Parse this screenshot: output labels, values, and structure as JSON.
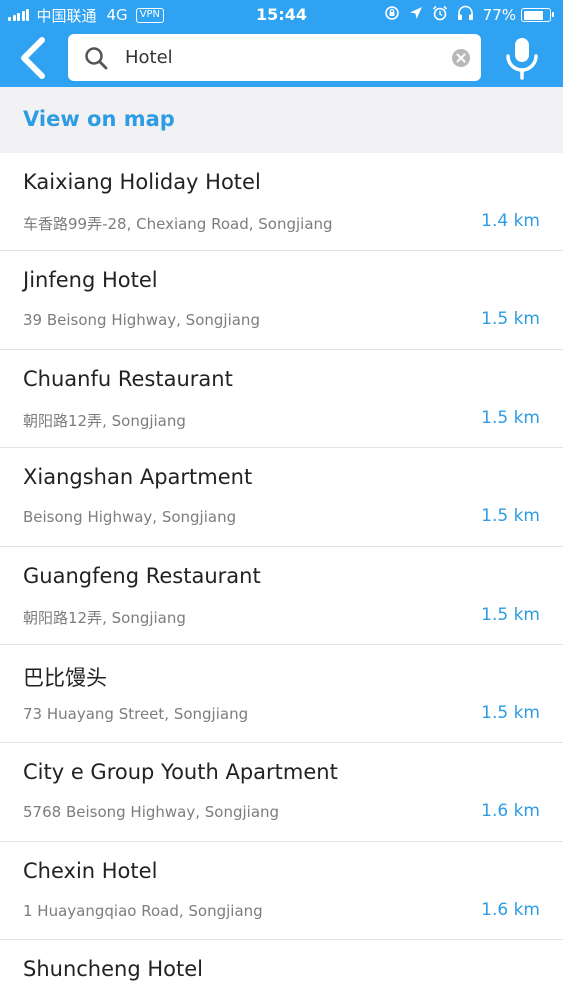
{
  "status_bar": {
    "carrier": "中国联通",
    "network": "4G",
    "vpn": "VPN",
    "time": "15:44",
    "battery": "77%",
    "battery_level": 0.77,
    "icons": [
      "screen-rotation-lock-icon",
      "location-icon",
      "alarm-icon",
      "headphones-icon",
      "battery-icon"
    ]
  },
  "header": {
    "back_icon": "chevron-left-icon",
    "search_icon": "search-icon",
    "search_value": "Hotel",
    "clear_icon": "clear-circle-icon",
    "mic_icon": "microphone-icon",
    "accent_color": "#2fa2f2"
  },
  "view_on_map": "View on map",
  "results": [
    {
      "name": "Kaixiang Holiday Hotel",
      "address": "车香路99弄-28, Chexiang Road, Songjiang",
      "distance": "1.4 km"
    },
    {
      "name": "Jinfeng Hotel",
      "address": "39 Beisong Highway, Songjiang",
      "distance": "1.5 km"
    },
    {
      "name": "Chuanfu Restaurant",
      "address": "朝阳路12弄, Songjiang",
      "distance": "1.5 km"
    },
    {
      "name": "Xiangshan Apartment",
      "address": "Beisong Highway, Songjiang",
      "distance": "1.5 km"
    },
    {
      "name": "Guangfeng Restaurant",
      "address": "朝阳路12弄, Songjiang",
      "distance": "1.5 km"
    },
    {
      "name": "巴比馒头",
      "address": "73 Huayang Street, Songjiang",
      "distance": "1.5 km"
    },
    {
      "name": "City e Group Youth Apartment",
      "address": "5768 Beisong Highway, Songjiang",
      "distance": "1.6 km"
    },
    {
      "name": "Chexin Hotel",
      "address": "1 Huayangqiao Road, Songjiang",
      "distance": "1.6 km"
    },
    {
      "name": "Shuncheng Hotel",
      "address": "",
      "distance": ""
    }
  ]
}
